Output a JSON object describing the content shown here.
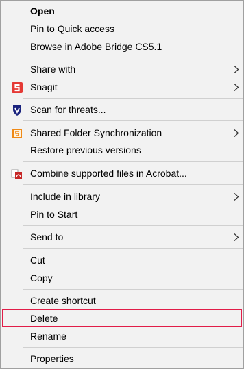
{
  "menu": {
    "items": [
      {
        "label": "Open"
      },
      {
        "label": "Pin to Quick access"
      },
      {
        "label": "Browse in Adobe Bridge CS5.1"
      },
      {
        "label": "Share with",
        "submenu": true
      },
      {
        "label": "Snagit",
        "submenu": true,
        "icon": "snagit-icon"
      },
      {
        "label": "Scan for threats...",
        "icon": "shield-icon"
      },
      {
        "label": "Shared Folder Synchronization",
        "submenu": true,
        "icon": "sync-folder-icon"
      },
      {
        "label": "Restore previous versions"
      },
      {
        "label": "Combine supported files in Acrobat...",
        "icon": "acrobat-icon"
      },
      {
        "label": "Include in library",
        "submenu": true
      },
      {
        "label": "Pin to Start"
      },
      {
        "label": "Send to",
        "submenu": true
      },
      {
        "label": "Cut"
      },
      {
        "label": "Copy"
      },
      {
        "label": "Create shortcut"
      },
      {
        "label": "Delete"
      },
      {
        "label": "Rename"
      },
      {
        "label": "Properties"
      }
    ]
  },
  "colors": {
    "menu_background": "#f2f2f2",
    "highlight_border": "#e11d48",
    "snagit_red": "#e53935",
    "shield_blue": "#1a237e",
    "sync_orange": "#ef8a17"
  }
}
